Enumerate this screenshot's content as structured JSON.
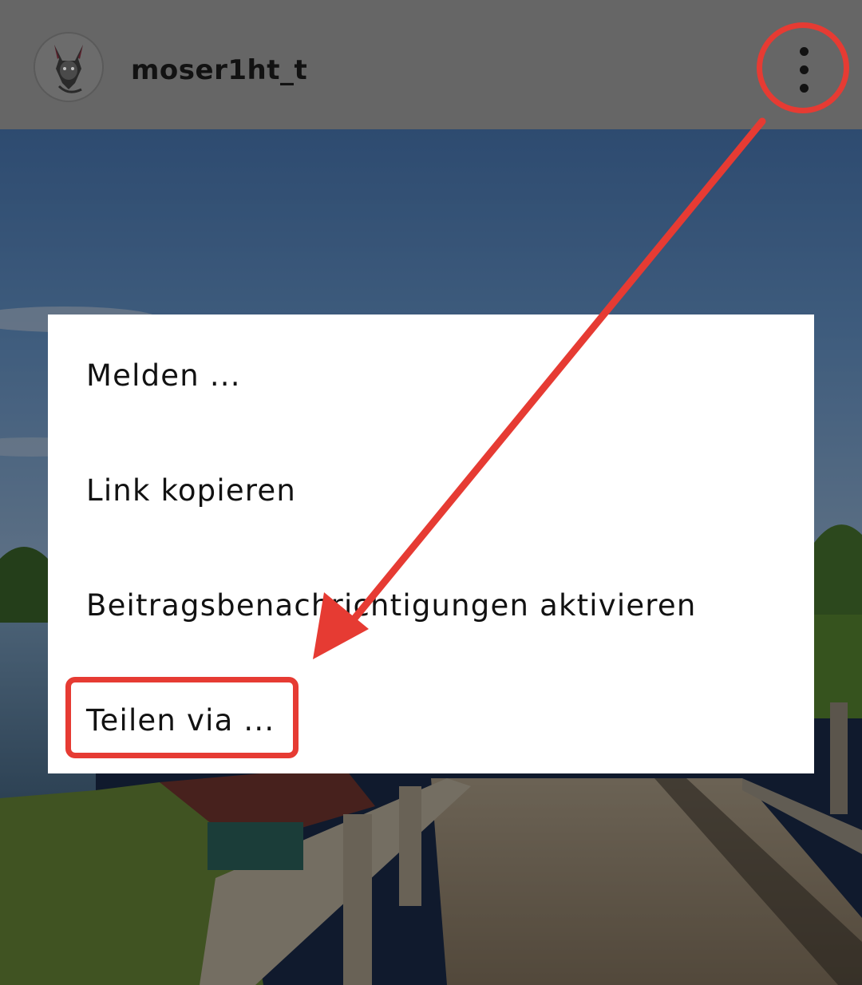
{
  "header": {
    "username": "moser1ht_t"
  },
  "menu": {
    "items": [
      {
        "label": "Melden ..."
      },
      {
        "label": "Link kopieren"
      },
      {
        "label": "Beitragsbenachrichtigungen aktivieren"
      },
      {
        "label": "Teilen via ..."
      }
    ]
  },
  "icons": {
    "more": "vertical-ellipsis-icon",
    "avatar": "avatar-image"
  },
  "colors": {
    "header_bg": "#666666",
    "menu_bg": "#ffffff",
    "annotation_red": "#e63b33",
    "text": "#121212"
  }
}
